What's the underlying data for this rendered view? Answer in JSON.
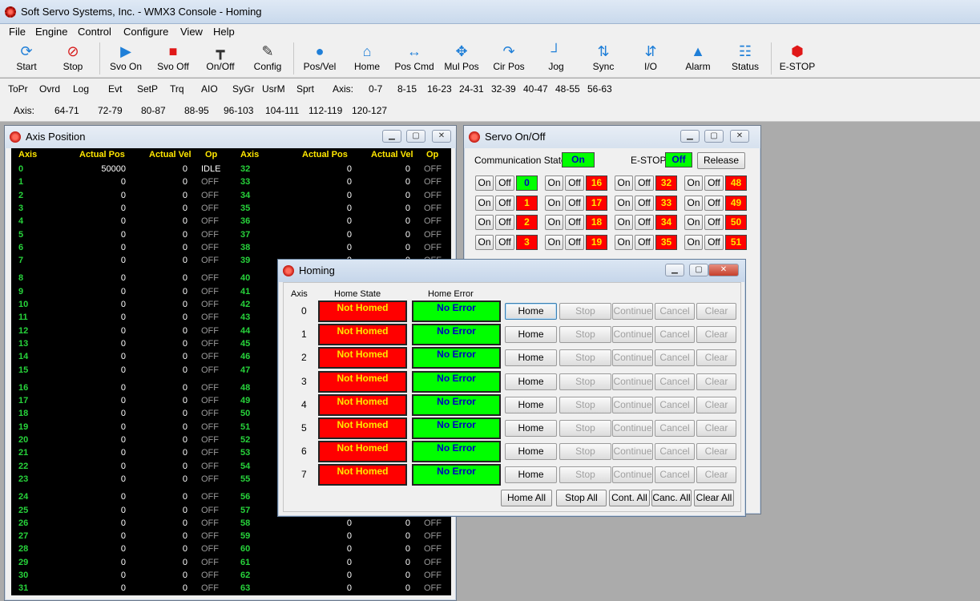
{
  "app": {
    "title": "Soft Servo Systems, Inc. - WMX3 Console - Homing"
  },
  "menu": [
    "File",
    "Engine",
    "Control",
    "Configure",
    "View",
    "Help"
  ],
  "toolbar": [
    {
      "label": "Start",
      "icon": "refresh-icon"
    },
    {
      "label": "Stop",
      "icon": "stop-cycle-icon"
    },
    {
      "label": "Svo On",
      "icon": "play-icon"
    },
    {
      "label": "Svo Off",
      "icon": "stop-square-icon"
    },
    {
      "label": "On/Off",
      "icon": "on-off-icon"
    },
    {
      "label": "Config",
      "icon": "wrench-icon"
    },
    {
      "label": "Pos/Vel",
      "icon": "map-pin-icon"
    },
    {
      "label": "Home",
      "icon": "home-icon"
    },
    {
      "label": "Pos Cmd",
      "icon": "horizontal-arrows-icon"
    },
    {
      "label": "Mul Pos",
      "icon": "move-arrows-icon"
    },
    {
      "label": "Cir Pos",
      "icon": "curved-arrow-icon"
    },
    {
      "label": "Jog",
      "icon": "jog-icon"
    },
    {
      "label": "Sync",
      "icon": "sync-arrows-icon"
    },
    {
      "label": "I/O",
      "icon": "io-arrows-icon"
    },
    {
      "label": "Alarm",
      "icon": "bell-icon"
    },
    {
      "label": "Status",
      "icon": "sliders-icon"
    },
    {
      "label": "E-STOP",
      "icon": "estop-icon"
    }
  ],
  "row2": [
    "ToPr",
    "Ovrd",
    "Log",
    "Evt",
    "SetP",
    "Trq",
    "AIO",
    "SyGr",
    "UsrM",
    "Sprt",
    "Axis:",
    "0-7",
    "8-15",
    "16-23",
    "24-31",
    "32-39",
    "40-47",
    "48-55",
    "56-63"
  ],
  "row3": [
    "Axis:",
    "64-71",
    "72-79",
    "80-87",
    "88-95",
    "96-103",
    "104-111",
    "112-119",
    "120-127"
  ],
  "axis_position": {
    "title": "Axis Position",
    "headers": [
      "Axis",
      "Actual Pos",
      "Actual Vel",
      "Op"
    ],
    "left": [
      [
        "0",
        "50000",
        "0",
        "IDLE"
      ],
      [
        "1",
        "0",
        "0",
        "OFF"
      ],
      [
        "2",
        "0",
        "0",
        "OFF"
      ],
      [
        "3",
        "0",
        "0",
        "OFF"
      ],
      [
        "4",
        "0",
        "0",
        "OFF"
      ],
      [
        "5",
        "0",
        "0",
        "OFF"
      ],
      [
        "6",
        "0",
        "0",
        "OFF"
      ],
      [
        "7",
        "0",
        "0",
        "OFF"
      ],
      [
        "8",
        "0",
        "0",
        "OFF"
      ],
      [
        "9",
        "0",
        "0",
        "OFF"
      ],
      [
        "10",
        "0",
        "0",
        "OFF"
      ],
      [
        "11",
        "0",
        "0",
        "OFF"
      ],
      [
        "12",
        "0",
        "0",
        "OFF"
      ],
      [
        "13",
        "0",
        "0",
        "OFF"
      ],
      [
        "14",
        "0",
        "0",
        "OFF"
      ],
      [
        "15",
        "0",
        "0",
        "OFF"
      ],
      [
        "16",
        "0",
        "0",
        "OFF"
      ],
      [
        "17",
        "0",
        "0",
        "OFF"
      ],
      [
        "18",
        "0",
        "0",
        "OFF"
      ],
      [
        "19",
        "0",
        "0",
        "OFF"
      ],
      [
        "20",
        "0",
        "0",
        "OFF"
      ],
      [
        "21",
        "0",
        "0",
        "OFF"
      ],
      [
        "22",
        "0",
        "0",
        "OFF"
      ],
      [
        "23",
        "0",
        "0",
        "OFF"
      ],
      [
        "24",
        "0",
        "0",
        "OFF"
      ],
      [
        "25",
        "0",
        "0",
        "OFF"
      ],
      [
        "26",
        "0",
        "0",
        "OFF"
      ],
      [
        "27",
        "0",
        "0",
        "OFF"
      ],
      [
        "28",
        "0",
        "0",
        "OFF"
      ],
      [
        "29",
        "0",
        "0",
        "OFF"
      ],
      [
        "30",
        "0",
        "0",
        "OFF"
      ],
      [
        "31",
        "0",
        "0",
        "OFF"
      ]
    ],
    "right": [
      [
        "32",
        "0",
        "0",
        "OFF"
      ],
      [
        "33",
        "0",
        "0",
        "OFF"
      ],
      [
        "34",
        "0",
        "0",
        "OFF"
      ],
      [
        "35",
        "0",
        "0",
        "OFF"
      ],
      [
        "36",
        "0",
        "0",
        "OFF"
      ],
      [
        "37",
        "0",
        "0",
        "OFF"
      ],
      [
        "38",
        "0",
        "0",
        "OFF"
      ],
      [
        "39",
        "0",
        "0",
        "OFF"
      ],
      [
        "40",
        "",
        "",
        ""
      ],
      [
        "41",
        "",
        "",
        ""
      ],
      [
        "42",
        "",
        "",
        ""
      ],
      [
        "43",
        "",
        "",
        ""
      ],
      [
        "44",
        "",
        "",
        ""
      ],
      [
        "45",
        "",
        "",
        ""
      ],
      [
        "46",
        "",
        "",
        ""
      ],
      [
        "47",
        "",
        "",
        ""
      ],
      [
        "48",
        "",
        "",
        ""
      ],
      [
        "49",
        "",
        "",
        ""
      ],
      [
        "50",
        "",
        "",
        ""
      ],
      [
        "51",
        "",
        "",
        ""
      ],
      [
        "52",
        "",
        "",
        ""
      ],
      [
        "53",
        "",
        "",
        ""
      ],
      [
        "54",
        "",
        "",
        ""
      ],
      [
        "55",
        "",
        "",
        ""
      ],
      [
        "56",
        "",
        "",
        ""
      ],
      [
        "57",
        "",
        "",
        ""
      ],
      [
        "58",
        "0",
        "0",
        "OFF"
      ],
      [
        "59",
        "0",
        "0",
        "OFF"
      ],
      [
        "60",
        "0",
        "0",
        "OFF"
      ],
      [
        "61",
        "0",
        "0",
        "OFF"
      ],
      [
        "62",
        "0",
        "0",
        "OFF"
      ],
      [
        "63",
        "0",
        "0",
        "OFF"
      ]
    ]
  },
  "servo": {
    "title": "Servo On/Off",
    "comm_label": "Communication State:",
    "comm_value": "On",
    "estop_label": "E-STOP:",
    "estop_value": "Off",
    "release_label": "Release",
    "on_label": "On",
    "off_label": "Off",
    "rows": [
      [
        "0",
        "16",
        "32",
        "48"
      ],
      [
        "1",
        "17",
        "33",
        "49"
      ],
      [
        "2",
        "18",
        "34",
        "50"
      ],
      [
        "3",
        "19",
        "35",
        "51"
      ]
    ]
  },
  "homing": {
    "title": "Homing",
    "col_axis": "Axis",
    "col_state": "Home State",
    "col_error": "Home Error",
    "state_text": "Not Homed",
    "error_text": "No Error",
    "axes": [
      "0",
      "1",
      "2",
      "3",
      "4",
      "5",
      "6",
      "7"
    ],
    "buttons": {
      "home": "Home",
      "stop": "Stop",
      "cont": "Continue",
      "cancel": "Cancel",
      "clear": "Clear"
    },
    "bottom": {
      "home_all": "Home All",
      "stop_all": "Stop All",
      "cont_all": "Cont. All",
      "canc_all": "Canc. All",
      "clear_all": "Clear All"
    }
  },
  "colors": {
    "indicator_red": "#ff0000",
    "indicator_green": "#00ff00",
    "grid_bg": "#000000",
    "axis_num": "#27d33b",
    "header_yellow": "#ffe600"
  }
}
